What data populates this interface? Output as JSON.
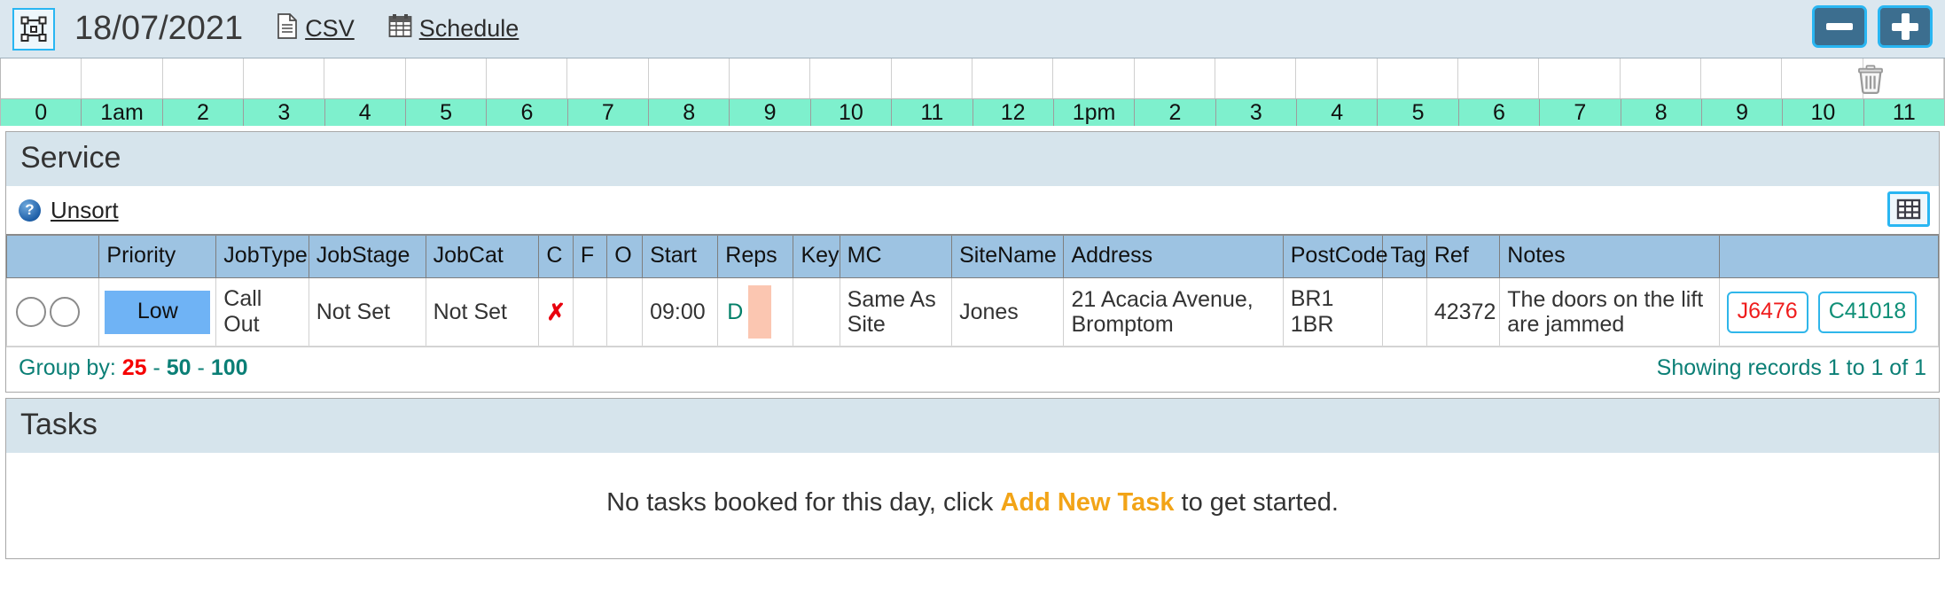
{
  "topbar": {
    "select_icon": "selection-frame-icon",
    "date": "18/07/2021",
    "links": [
      {
        "icon": "file-document-icon",
        "label": "CSV"
      },
      {
        "icon": "calendar-icon",
        "label": "Schedule"
      }
    ],
    "buttons": [
      {
        "name": "collapse-button",
        "glyph": "minus-icon"
      },
      {
        "name": "expand-button",
        "glyph": "plus-icon"
      }
    ]
  },
  "timeline": {
    "delete_icon": "trash-icon",
    "hours": [
      "0",
      "1am",
      "2",
      "3",
      "4",
      "5",
      "6",
      "7",
      "8",
      "9",
      "10",
      "11",
      "12",
      "1pm",
      "2",
      "3",
      "4",
      "5",
      "6",
      "7",
      "8",
      "9",
      "10",
      "11"
    ],
    "band_color": "#7ef0cd"
  },
  "service": {
    "title": "Service",
    "help_icon": "help-circle-icon",
    "unsort_label": "Unsort",
    "grid_icon": "table-grid-icon",
    "columns": [
      "",
      "Priority",
      "JobType",
      "JobStage",
      "JobCat",
      "C",
      "F",
      "O",
      "Start",
      "Reps",
      "Key",
      "MC",
      "SiteName",
      "Address",
      "PostCode",
      "Tag",
      "Ref",
      "Notes",
      ""
    ],
    "rows": [
      {
        "select": [
          "radio-unselected",
          "radio-unselected"
        ],
        "priority": "Low",
        "priority_color": "#6fb3f5",
        "jobtype": "Call Out",
        "jobstage": "Not Set",
        "jobcat": "Not Set",
        "c": "✗",
        "c_color": "#e8000d",
        "f": "",
        "o": "",
        "start": "09:00",
        "reps": "D",
        "reps_bar_color": "#fbc6b1",
        "key": "",
        "mc": "Same As Site",
        "sitename": "Jones",
        "address": "21 Acacia Avenue, Bromptom",
        "postcode": "BR1 1BR",
        "tag": "",
        "ref": "42372",
        "notes": "The doors on the lift are jammed",
        "chips": [
          {
            "label": "J6476",
            "color": "#ef1d1d"
          },
          {
            "label": "C41018",
            "color": "#0f8f77"
          }
        ]
      }
    ],
    "footer": {
      "group_by_label": "Group by:",
      "options": [
        {
          "label": "25",
          "active": true
        },
        {
          "label": "50",
          "active": false
        },
        {
          "label": "100",
          "active": false
        }
      ],
      "separator": "-",
      "showing": "Showing records 1 to 1 of 1"
    }
  },
  "tasks": {
    "title": "Tasks",
    "empty_prefix": "No tasks booked for this day, click ",
    "empty_action": "Add New Task",
    "empty_suffix": " to get started."
  }
}
